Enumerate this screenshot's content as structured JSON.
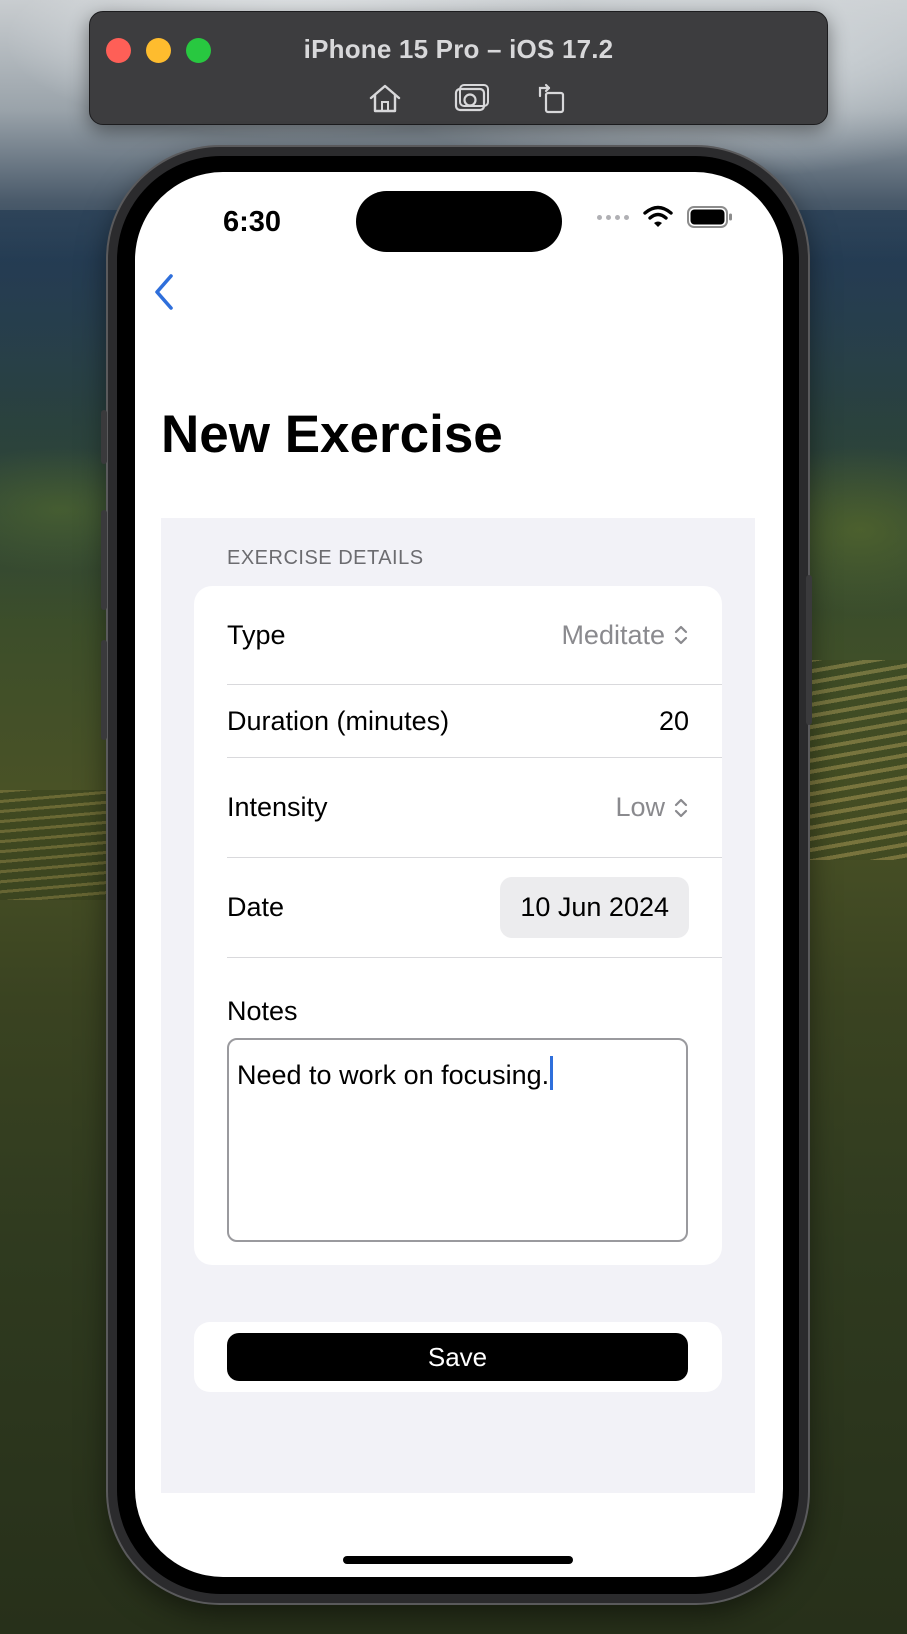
{
  "simulator": {
    "title": "iPhone 15 Pro – iOS 17.2",
    "tools": [
      "home-icon",
      "screenshot-icon",
      "rotate-icon"
    ]
  },
  "status_bar": {
    "time": "6:30",
    "icons": [
      "cellular-dots-icon",
      "wifi-icon",
      "battery-icon"
    ]
  },
  "nav": {
    "back_icon": "chevron-left-icon"
  },
  "page": {
    "title": "New Exercise"
  },
  "form": {
    "section_header": "EXERCISE DETAILS",
    "type": {
      "label": "Type",
      "value": "Meditate"
    },
    "duration": {
      "label": "Duration (minutes)",
      "value": "20"
    },
    "intensity": {
      "label": "Intensity",
      "value": "Low"
    },
    "date": {
      "label": "Date",
      "value": "10 Jun 2024"
    },
    "notes": {
      "label": "Notes",
      "value": "Need to work on focusing."
    }
  },
  "actions": {
    "save_label": "Save"
  },
  "colors": {
    "accent": "#2f6fdb",
    "grouped_background": "#f2f2f7",
    "secondary_text": "#8a8a8e",
    "save_button": "#000000"
  }
}
